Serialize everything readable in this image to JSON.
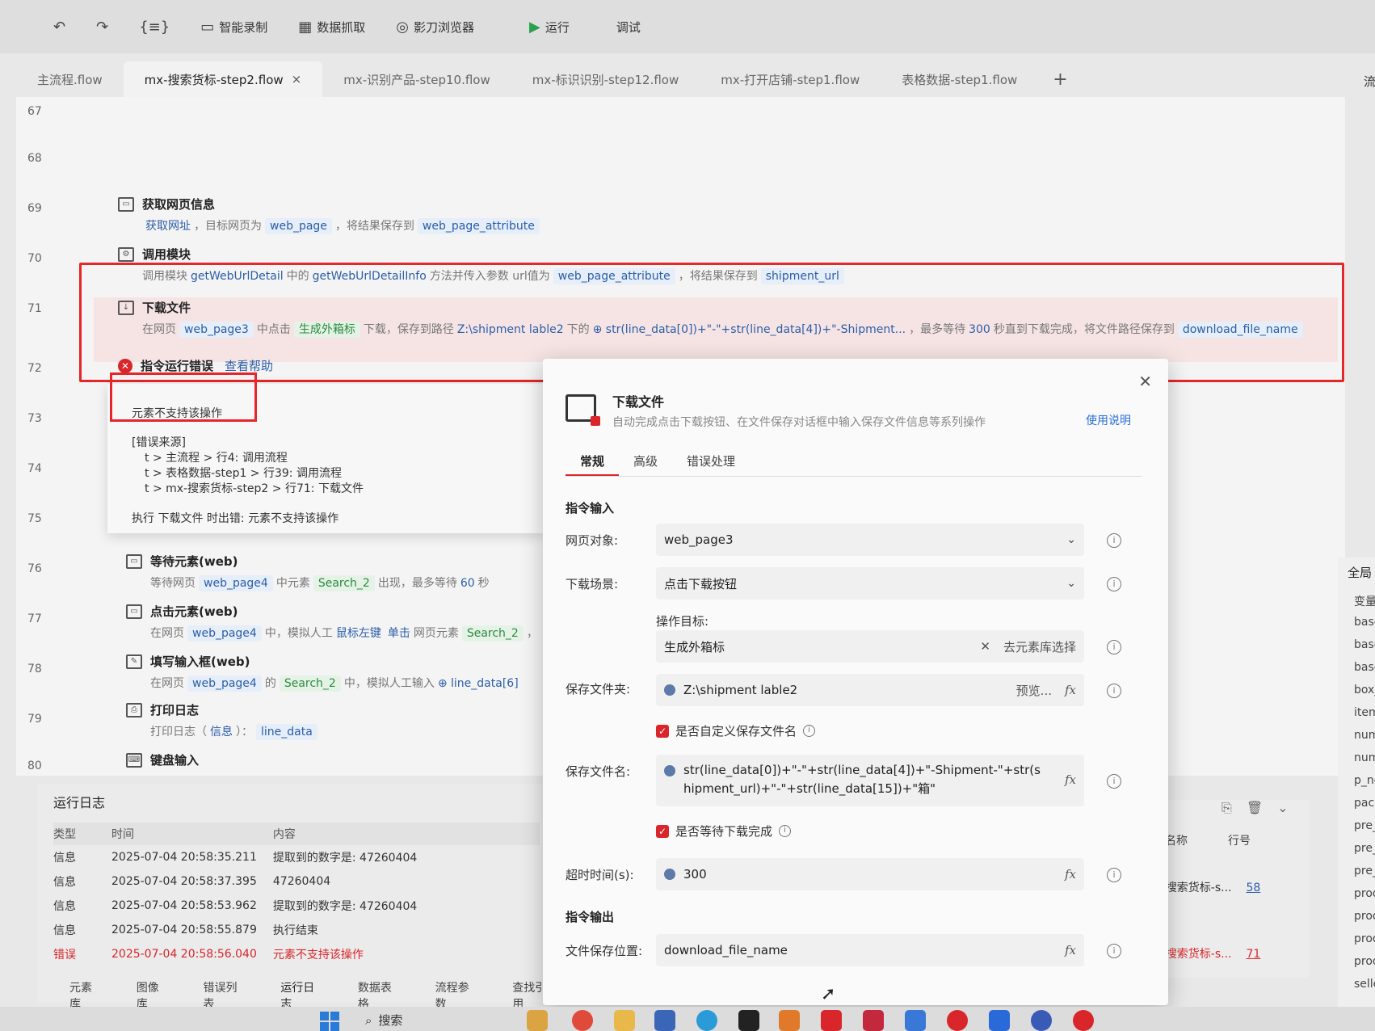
{
  "toolbar": {
    "undo_icon": "undo-icon",
    "redo_icon": "redo-icon",
    "format_icon": "braces-icon",
    "smart_record": "智能录制",
    "data_capture": "数据抓取",
    "shadow_browser": "影刀浏览器",
    "run": "运行",
    "debug": "调试"
  },
  "tabs": [
    {
      "label": "主流程.flow"
    },
    {
      "label": "mx-搜索货标-step2.flow",
      "active": true
    },
    {
      "label": "mx-识别产品-step10.flow"
    },
    {
      "label": "mx-标识识别-step12.flow"
    },
    {
      "label": "mx-打开店铺-step1.flow"
    },
    {
      "label": "表格数据-step1.flow"
    }
  ],
  "tab_add": "+",
  "tab_close": "×",
  "right_edge_char": "流",
  "line_numbers": [
    "67",
    "68",
    "69",
    "70",
    "71",
    "72",
    "73",
    "74",
    "75",
    "76",
    "77",
    "78",
    "79",
    "80"
  ],
  "steps": {
    "s69": {
      "title": "获取网页信息",
      "p1": "获取网址",
      "p2": "，目标网页为",
      "t1": "web_page",
      "p3": "，将结果保存到",
      "t2": "web_page_attribute"
    },
    "s70": {
      "title": "调用模块",
      "p1": "调用模块",
      "l1": "getWebUrlDetail",
      "p2": "中的",
      "l2": "getWebUrlDetailInfo",
      "p3": "方法并传入参数 url值为",
      "t1": "web_page_attribute",
      "p4": "，将结果保存到",
      "t2": "shipment_url"
    },
    "s71": {
      "title": "下载文件",
      "p1": "在网页",
      "t1": "web_page3",
      "p2": "中点击",
      "t2": "生成外箱标",
      "p3": "下载，保存到路径",
      "l1": "Z:\\shipment lable2",
      "p4": "下的",
      "l2": "⊕ str(line_data[0])+\"-\"+str(line_data[4])+\"-Shipment...",
      "p5": "，最多等待",
      "l3": "300",
      "p6": "秒直到下载完成，将文件路径保存到",
      "t3": "download_file_name"
    },
    "s72": {
      "title": "指令运行错误",
      "help": "查看帮助"
    },
    "s76": {
      "title": "等待元素(web)",
      "p1": "等待网页",
      "t1": "web_page4",
      "p2": "中元素",
      "t2": "Search_2",
      "p3": "出现，最多等待",
      "l1": "60",
      "p4": "秒"
    },
    "s77": {
      "title": "点击元素(web)",
      "p1": "在网页",
      "t1": "web_page4",
      "p2": "中，模拟人工",
      "l1": "鼠标左键",
      "l2": "单击",
      "p3": "网页元素",
      "t2": "Search_2",
      "p4": "，"
    },
    "s78": {
      "title": "填写输入框(web)",
      "p1": "在网页",
      "t1": "web_page4",
      "p2": "的",
      "t2": "Search_2",
      "p3": "中，模拟人工输入",
      "l1": "⊕ line_data[6]"
    },
    "s79": {
      "title": "打印日志",
      "p1": "打印日志（",
      "l1": "信息",
      "p2": "）：",
      "t1": "line_data"
    },
    "s80": {
      "title": "键盘输入"
    }
  },
  "error_panel": {
    "message": "元素不支持该操作",
    "source_title": "[错误来源]",
    "source_lines": [
      "t > 主流程 > 行4: 调用流程",
      "t > 表格数据-step1 > 行39: 调用流程",
      "t > mx-搜索货标-step2 > 行71: 下载文件"
    ],
    "bottom": "执行 下载文件 时出错: 元素不支持该操作"
  },
  "log": {
    "title": "运行日志",
    "headers": [
      "类型",
      "时间",
      "内容"
    ],
    "rows": [
      {
        "type": "信息",
        "time": "2025-07-04 20:58:35.211",
        "content": "提取到的数字是: 47260404"
      },
      {
        "type": "信息",
        "time": "2025-07-04 20:58:37.395",
        "content": "47260404"
      },
      {
        "type": "信息",
        "time": "2025-07-04 20:58:53.962",
        "content": "提取到的数字是: 47260404"
      },
      {
        "type": "信息",
        "time": "2025-07-04 20:58:55.879",
        "content": "执行结束"
      },
      {
        "type": "错误",
        "time": "2025-07-04 20:58:56.040",
        "content": "元素不支持该操作"
      }
    ],
    "tabs": [
      "元素库",
      "图像库",
      "错误列表",
      "运行日志",
      "数据表格",
      "流程参数",
      "查找引用"
    ]
  },
  "right_panel": {
    "headers": [
      "程名称",
      "行号"
    ],
    "rows": [
      {
        "name": "<-搜索货标-s...",
        "line": "58"
      },
      {
        "name": "<-搜索货标-s...",
        "line": "71",
        "error": true
      }
    ]
  },
  "var_panel": {
    "title": "全局",
    "subtitle": "变量",
    "items": [
      "base",
      "base",
      "base",
      "box_",
      "item_",
      "numb",
      "numb",
      "p_no_",
      "packa",
      "pre_s",
      "pre_s",
      "pre_s",
      "produ",
      "produ",
      "produ",
      "produ",
      "seller_i"
    ]
  },
  "dialog": {
    "title": "下载文件",
    "subtitle": "自动完成点击下载按钮、在文件保存对话框中输入保存文件信息等系列操作",
    "help": "使用说明",
    "tabs": [
      "常规",
      "高级",
      "错误处理"
    ],
    "section_input": "指令输入",
    "section_output": "指令输出",
    "fields": {
      "web_object_label": "网页对象:",
      "web_object_value": "web_page3",
      "scene_label": "下载场景:",
      "scene_value": "点击下载按钮",
      "target_label": "操作目标:",
      "target_value": "生成外箱标",
      "target_pick": "去元素库选择",
      "folder_label": "保存文件夹:",
      "folder_value": "Z:\\shipment lable2",
      "folder_preview": "预览...",
      "custom_name_label": "是否自定义保存文件名",
      "filename_label": "保存文件名:",
      "filename_value": "str(line_data[0])+\"-\"+str(line_data[4])+\"-Shipment-\"+str(shipment_url)+\"-\"+str(line_data[15])+\"箱\"",
      "wait_label": "是否等待下载完成",
      "timeout_label": "超时时间(s):",
      "timeout_value": "300",
      "output_label": "文件保存位置:",
      "output_value": "download_file_name"
    }
  },
  "taskbar": {
    "search": "搜索"
  },
  "colors": {
    "accent_red": "#d8262b",
    "tag_blue": "#2b5ea8",
    "tag_green": "#2c8a3e",
    "link_blue": "#2b6fd6"
  }
}
